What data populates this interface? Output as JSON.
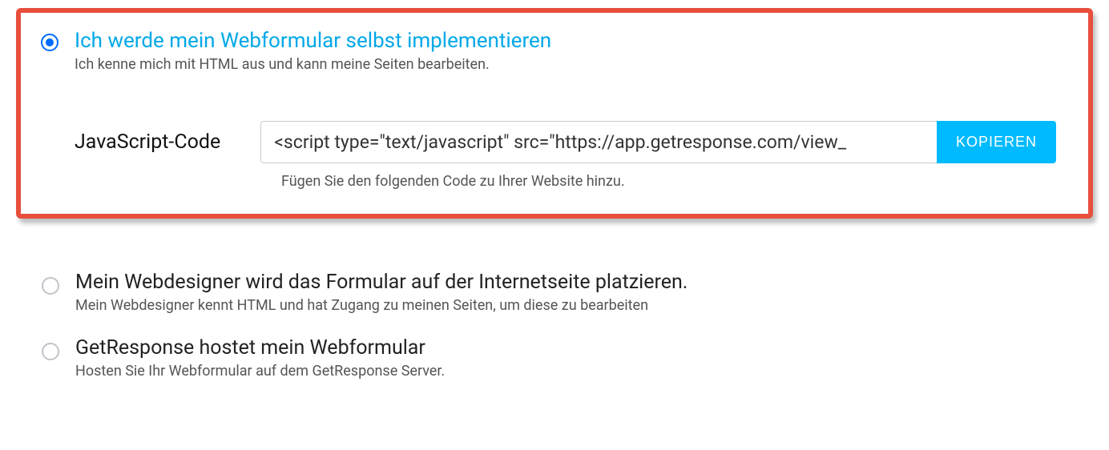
{
  "option1": {
    "title": "Ich werde mein Webformular selbst implementieren",
    "desc": "Ich kenne mich mit HTML aus und kann meine Seiten bearbeiten.",
    "code_label": "JavaScript-Code",
    "code_value": "<script type=\"text/javascript\" src=\"https://app.getresponse.com/view_",
    "copy_button": "KOPIEREN",
    "helper": "Fügen Sie den folgenden Code zu Ihrer Website hinzu."
  },
  "option2": {
    "title": "Mein Webdesigner wird das Formular auf der Internetseite platzieren.",
    "desc": "Mein Webdesigner kennt HTML und hat Zugang zu meinen Seiten, um diese zu bearbeiten"
  },
  "option3": {
    "title": "GetResponse hostet mein Webformular",
    "desc": "Hosten Sie Ihr Webformular auf dem GetResponse Server."
  }
}
